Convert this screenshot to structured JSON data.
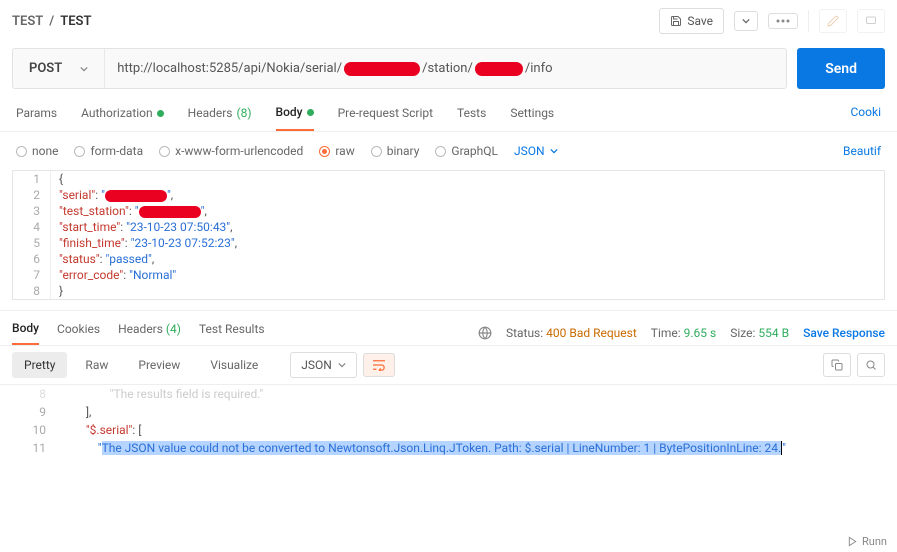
{
  "breadcrumb": {
    "parent": "TEST",
    "sep": "/",
    "current": "TEST"
  },
  "header": {
    "save": "Save"
  },
  "request": {
    "method": "POST",
    "url_prefix": "http://localhost:5285/api/Nokia/serial/",
    "url_mid": "/station/",
    "url_suffix": "/info",
    "send": "Send"
  },
  "tabs": {
    "params": "Params",
    "auth": "Authorization",
    "headers": "Headers",
    "headers_count": "(8)",
    "body": "Body",
    "prereq": "Pre-request Script",
    "tests": "Tests",
    "settings": "Settings",
    "cookies": "Cooki"
  },
  "bodytypes": {
    "none": "none",
    "formdata": "form-data",
    "urlencoded": "x-www-form-urlencoded",
    "raw": "raw",
    "binary": "binary",
    "graphql": "GraphQL",
    "format": "JSON",
    "beautify": "Beautif"
  },
  "body_lines": [
    {
      "n": "1",
      "brace": "{"
    },
    {
      "n": "2",
      "key": "\"serial\"",
      "colon": ": ",
      "val_open": "\"",
      "redact": true,
      "val_close": "\"",
      "comma": ","
    },
    {
      "n": "3",
      "key": "\"test_station\"",
      "colon": ": ",
      "val_open": "\"",
      "redact": true,
      "val_close": "\"",
      "comma": ","
    },
    {
      "n": "4",
      "key": "\"start_time\"",
      "colon": ": ",
      "val": "\"23-10-23 07:50:43\"",
      "comma": ","
    },
    {
      "n": "5",
      "key": "\"finish_time\"",
      "colon": ": ",
      "val": "\"23-10-23 07:52:23\"",
      "comma": ","
    },
    {
      "n": "6",
      "key": "\"status\"",
      "colon": ": ",
      "val": "\"passed\"",
      "comma": ","
    },
    {
      "n": "7",
      "key": "\"error_code\"",
      "colon": ": ",
      "val": "\"Normal\""
    },
    {
      "n": "8",
      "brace": "}"
    }
  ],
  "resp_tabs": {
    "body": "Body",
    "cookies": "Cookies",
    "headers": "Headers",
    "headers_count": "(4)",
    "tests": "Test Results"
  },
  "status": {
    "label": "Status:",
    "code": "400 Bad Request",
    "time_label": "Time:",
    "time": "9.65 s",
    "size_label": "Size:",
    "size": "554 B",
    "save": "Save Response"
  },
  "views": {
    "pretty": "Pretty",
    "raw": "Raw",
    "preview": "Preview",
    "visualize": "Visualize",
    "format": "JSON"
  },
  "response_lines": {
    "faded_prev": "    \"The results field is required.\"",
    "l9": "],",
    "l10_key": "\"$.serial\"",
    "l10_rest": ": [",
    "l11_open": "    \"",
    "l11_msg": "The JSON value could not be converted to Newtonsoft.Json.Linq.JToken. Path: $.serial | LineNumber: 1 | BytePositionInLine: 24.",
    "l11_close": "\""
  },
  "footer": {
    "runner": "Runn"
  }
}
